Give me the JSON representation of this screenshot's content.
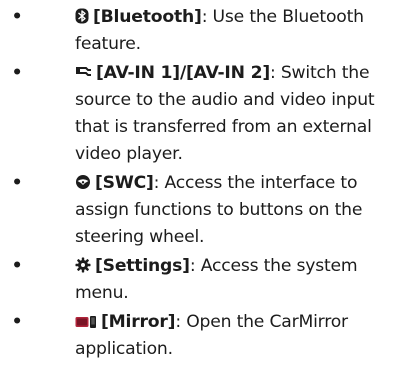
{
  "items": [
    {
      "icon": "bluetooth-icon",
      "label": "[Bluetooth]",
      "description": "Use the Bluetooth feature."
    },
    {
      "icon": "av-in-cable-icon",
      "label": "[AV-IN 1]/[AV-IN 2]",
      "description": "Switch the source to the audio and video input that is transferred from an external video player."
    },
    {
      "icon": "steering-wheel-icon",
      "label": "[SWC]",
      "description": "Access the interface to assign functions to buttons on the steering wheel."
    },
    {
      "icon": "gear-icon",
      "label": "[Settings]",
      "description": "Access the system menu."
    },
    {
      "icon": "car-mirror-icon",
      "label": "[Mirror]",
      "description": "Open the CarMirror application."
    }
  ],
  "bullet_char": "•",
  "separator": ": "
}
